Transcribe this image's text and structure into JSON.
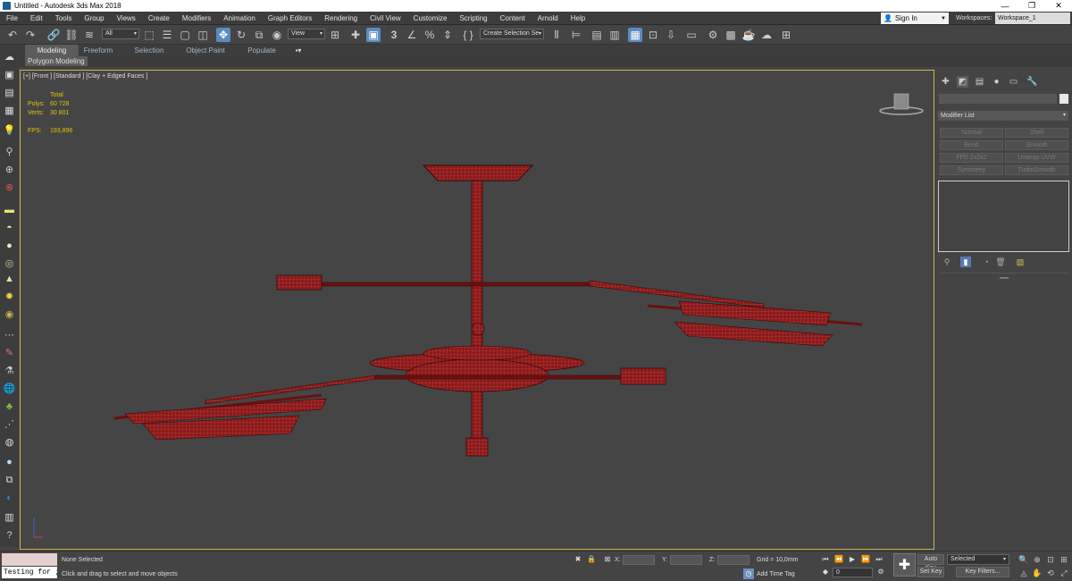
{
  "window": {
    "title": "Untitled - Autodesk 3ds Max 2018",
    "minimize": "—",
    "restore": "❐",
    "close": "✕"
  },
  "menu": [
    "File",
    "Edit",
    "Tools",
    "Group",
    "Views",
    "Create",
    "Modifiers",
    "Animation",
    "Graph Editors",
    "Rendering",
    "Civil View",
    "Customize",
    "Scripting",
    "Content",
    "Arnold",
    "Help"
  ],
  "account": {
    "signin": "Sign In",
    "workspaces_label": "Workspaces:",
    "workspace": "Workspace_1"
  },
  "toolbar": {
    "selection_filter": "All",
    "ref_coord": "View",
    "named_selection": "Create Selection Se",
    "icons": [
      "undo-icon",
      "redo-icon",
      "select-link-icon",
      "unlink-icon",
      "bind-space-warp-icon",
      "select-object-icon",
      "select-by-name-icon",
      "rect-region-icon",
      "window-crossing-icon",
      "select-move-icon",
      "select-rotate-icon",
      "select-scale-icon",
      "place-icon",
      "use-pivot-icon",
      "keyboard-shortcut-icon",
      "snaps-3d-icon",
      "angle-snap-icon",
      "percent-snap-icon",
      "spinner-snap-icon",
      "edit-named-sets-icon",
      "mirror-icon",
      "align-icon",
      "layer-explorer-icon",
      "scene-explorer-icon",
      "toggle-ribbon-icon",
      "curve-editor-icon",
      "schematic-view-icon",
      "material-editor-icon",
      "render-setup-icon",
      "rendered-frame-icon",
      "render-production-icon",
      "render-iterative-icon",
      "render-cloud-icon"
    ]
  },
  "ribbon": {
    "tabs": [
      "Modeling",
      "Freeform",
      "Selection",
      "Object Paint",
      "Populate"
    ],
    "active_tab": "Modeling",
    "sub": "Polygon Modeling",
    "options": "▪▾"
  },
  "viewport": {
    "label": "[+] [Front ] [Standard ] [Clay + Edged Faces ]",
    "stats": {
      "total_label": "Total",
      "polys_label": "Polys:",
      "polys": "60 728",
      "verts_label": "Verts:",
      "verts": "30 801",
      "fps_label": "FPS:",
      "fps": "193,896"
    },
    "colors": {
      "model": "#8a1a1a",
      "model_wire": "#e06060",
      "border": "#c9b54a"
    }
  },
  "command_panel": {
    "tabs": [
      "create-icon",
      "modify-icon",
      "hierarchy-icon",
      "motion-icon",
      "display-icon",
      "utilities-icon"
    ],
    "modifier_list": "Modifier List",
    "buttons": [
      "Normal",
      "Shell",
      "Bend",
      "Smooth",
      "FFD 2x2x2",
      "Unwrap UVW",
      "Symmetry",
      "TurboSmooth"
    ]
  },
  "status": {
    "selection": "None Selected",
    "prompt": "Click and drag to select and move objects",
    "maxscript_input": "Testing for ;",
    "x_label": "X:",
    "y_label": "Y:",
    "z_label": "Z:",
    "grid": "Grid = 10,0mm",
    "add_time_tag": "Add Time Tag",
    "frame": "0",
    "auto_key": "Auto Key",
    "set_key": "Set Key",
    "selected": "Selected",
    "key_filters": "Key Filters..."
  }
}
